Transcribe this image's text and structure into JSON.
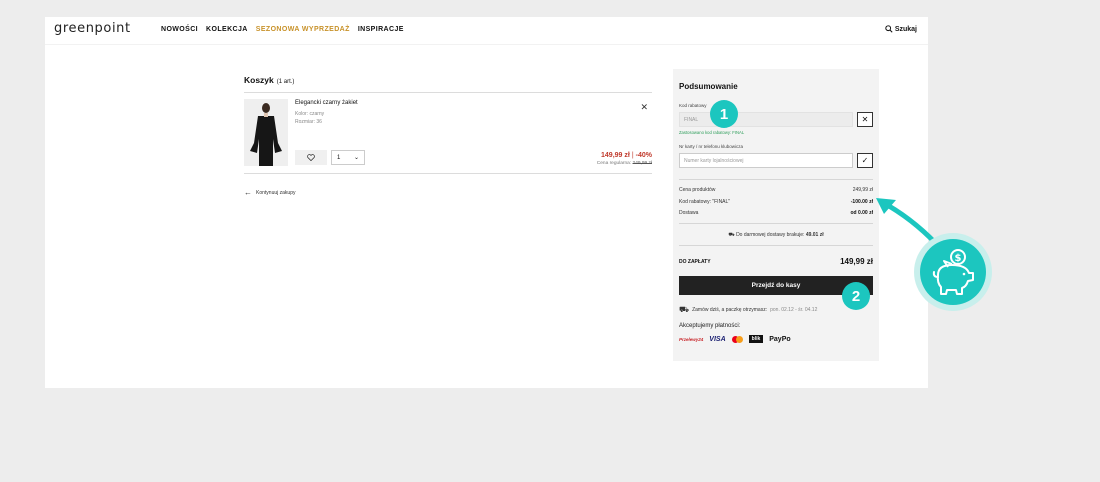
{
  "header": {
    "logo": "greenpoint",
    "nav": [
      "NOWOŚCI",
      "KOLEKCJA",
      "SEZONOWA WYPRZEDAŻ",
      "INSPIRACJE"
    ],
    "search_label": "Szukaj"
  },
  "cart": {
    "title": "Koszyk",
    "count": "(1 art.)",
    "item": {
      "name": "Elegancki czarny żakiet",
      "color": "Kolor: czarny",
      "size": "Rozmiar: 36",
      "qty": "1",
      "price": "149,99 zł",
      "discount": "-40%",
      "regular_label": "Cena regularna:",
      "regular_price": "249,99 zł"
    },
    "continue": "Kontynuuj zakupy"
  },
  "summary": {
    "title": "Podsumowanie",
    "code_label": "Kod rabatowy",
    "code_value": "FINAL",
    "code_applied": "Zastosowano kod rabatowy: FINAL",
    "card_label": "Nr karty / nr telefonu klubowicza",
    "card_placeholder": "Numer karty lojalnościowej",
    "products_label": "Cena produktów",
    "products_value": "249,99 zł",
    "discount_label": "Kod rabatowy: \"FINAL\"",
    "discount_value": "-100.00 zł",
    "shipping_label": "Dostawa",
    "shipping_value": "od 0.00 zł",
    "free_text": "Do darmowej dostawy brakuje:",
    "free_value": "49.01 zł",
    "total_label": "DO ZAPŁATY",
    "total_value": "149,99 zł",
    "checkout": "Przejdź do kasy",
    "delivery_text": "Zamów dziś, a paczkę otrzymasz:",
    "delivery_dates": "pon. 02.12 - śr. 04.12",
    "accept_label": "Akceptujemy płatności:",
    "payments": [
      "Przelewy24",
      "VISA",
      "blik",
      "PayPo"
    ]
  },
  "annotations": [
    "1",
    "2"
  ],
  "colors": {
    "accent": "#1cc6bf",
    "sale": "#c8922a",
    "price": "#c0392b"
  }
}
